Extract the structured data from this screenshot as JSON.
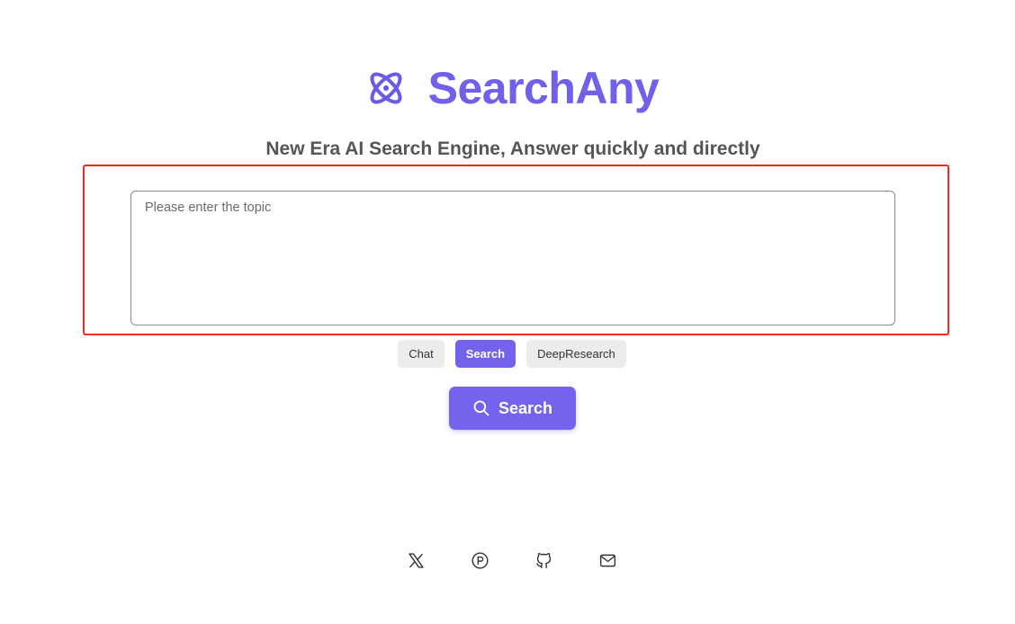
{
  "header": {
    "title": "SearchAny",
    "logo_icon": "atom-icon",
    "brand_color": "#7060ea"
  },
  "tagline": "New Era AI Search Engine, Answer quickly and directly",
  "search": {
    "placeholder": "Please enter the topic",
    "value": ""
  },
  "modes": [
    {
      "label": "Chat",
      "active": false
    },
    {
      "label": "Search",
      "active": true
    },
    {
      "label": "DeepResearch",
      "active": false
    }
  ],
  "search_button": {
    "label": "Search",
    "icon": "search-icon",
    "color": "#7463ec"
  },
  "highlight_color": "#ee2a24",
  "footer": {
    "links": [
      {
        "icon": "x-twitter-icon"
      },
      {
        "icon": "producthunt-icon"
      },
      {
        "icon": "github-icon"
      },
      {
        "icon": "mail-icon"
      }
    ]
  }
}
